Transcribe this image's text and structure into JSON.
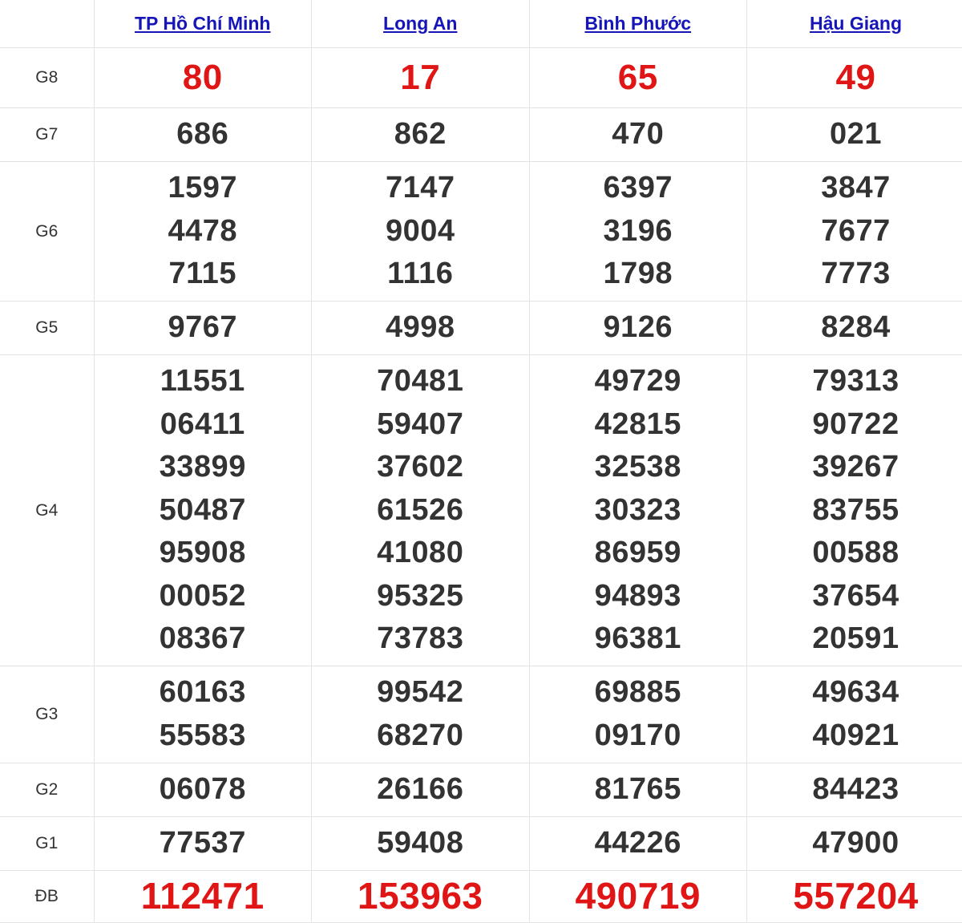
{
  "provinces": [
    "TP Hồ Chí Minh",
    "Long An",
    "Bình Phước",
    "Hậu Giang"
  ],
  "prizes": {
    "g8": {
      "label": "G8",
      "values": [
        "80",
        "17",
        "65",
        "49"
      ]
    },
    "g7": {
      "label": "G7",
      "values": [
        "686",
        "862",
        "470",
        "021"
      ]
    },
    "g6": {
      "label": "G6",
      "values": [
        [
          "1597",
          "4478",
          "7115"
        ],
        [
          "7147",
          "9004",
          "1116"
        ],
        [
          "6397",
          "3196",
          "1798"
        ],
        [
          "3847",
          "7677",
          "7773"
        ]
      ]
    },
    "g5": {
      "label": "G5",
      "values": [
        "9767",
        "4998",
        "9126",
        "8284"
      ]
    },
    "g4": {
      "label": "G4",
      "values": [
        [
          "11551",
          "06411",
          "33899",
          "50487",
          "95908",
          "00052",
          "08367"
        ],
        [
          "70481",
          "59407",
          "37602",
          "61526",
          "41080",
          "95325",
          "73783"
        ],
        [
          "49729",
          "42815",
          "32538",
          "30323",
          "86959",
          "94893",
          "96381"
        ],
        [
          "79313",
          "90722",
          "39267",
          "83755",
          "00588",
          "37654",
          "20591"
        ]
      ]
    },
    "g3": {
      "label": "G3",
      "values": [
        [
          "60163",
          "55583"
        ],
        [
          "99542",
          "68270"
        ],
        [
          "69885",
          "09170"
        ],
        [
          "49634",
          "40921"
        ]
      ]
    },
    "g2": {
      "label": "G2",
      "values": [
        "06078",
        "26166",
        "81765",
        "84423"
      ]
    },
    "g1": {
      "label": "G1",
      "values": [
        "77537",
        "59408",
        "44226",
        "47900"
      ]
    },
    "db": {
      "label": "ĐB",
      "values": [
        "112471",
        "153963",
        "490719",
        "557204"
      ]
    }
  },
  "colors": {
    "link": "#1515b8",
    "highlight": "#e01515",
    "text": "#333333",
    "border": "#e3e3e3"
  }
}
